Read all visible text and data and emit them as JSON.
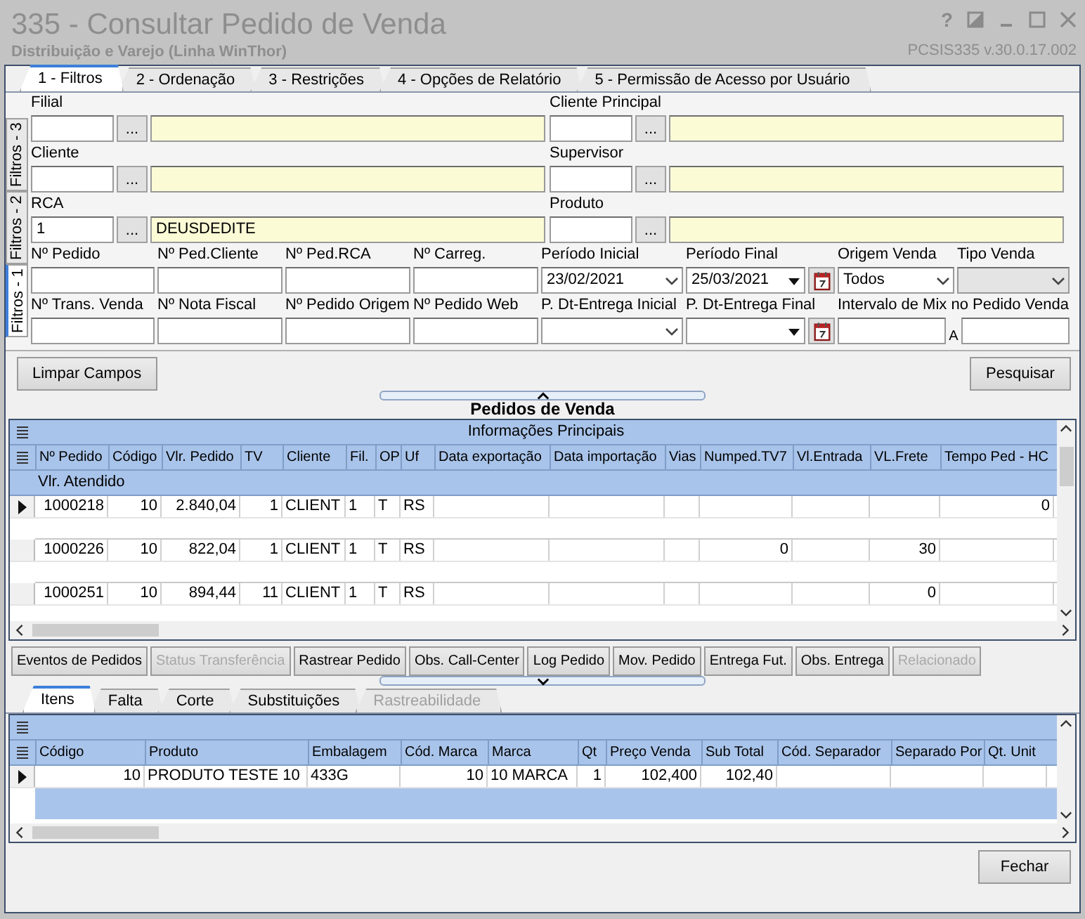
{
  "window": {
    "title": "335 - Consultar Pedido de Venda",
    "subtitle": "Distribuição e Varejo (Linha WinThor)",
    "version": "PCSIS335  v.30.0.17.002",
    "help": "?"
  },
  "tabs": [
    {
      "label": "1 - Filtros",
      "selected": true
    },
    {
      "label": "2 - Ordenação",
      "selected": false
    },
    {
      "label": "3 - Restrições",
      "selected": false
    },
    {
      "label": "4 - Opções de Relatório",
      "selected": false
    },
    {
      "label": "5 - Permissão de Acesso por Usuário",
      "selected": false
    }
  ],
  "side_tabs": [
    {
      "label": "Filtros - 3",
      "selected": false
    },
    {
      "label": "Filtros - 2",
      "selected": false
    },
    {
      "label": "Filtros - 1",
      "selected": true
    }
  ],
  "lookups": [
    {
      "label": "Filial"
    },
    {
      "label": "Cliente Principal"
    },
    {
      "label": "Cliente"
    },
    {
      "label": "Supervisor"
    },
    {
      "label": "RCA",
      "code": "1",
      "name": "DEUSDEDITE"
    },
    {
      "label": "Produto"
    }
  ],
  "lookup_button": "...",
  "filter_fields": [
    {
      "label": "Nº Pedido",
      "kind": "text"
    },
    {
      "label": "Nº Ped.Cliente",
      "kind": "text"
    },
    {
      "label": "Nº Ped.RCA",
      "kind": "text"
    },
    {
      "label": "Nº Carreg.",
      "kind": "text"
    },
    {
      "label": "Período Inicial",
      "kind": "combo",
      "value": "23/02/2021",
      "disabled": false
    },
    {
      "label": "Período Final",
      "kind": "date",
      "value": "25/03/2021"
    },
    {
      "label": "Origem Venda",
      "kind": "combo",
      "value": "Todos",
      "disabled": false
    },
    {
      "label": "Tipo Venda",
      "kind": "combo",
      "disabled": true
    },
    {
      "label": "Nº Trans. Venda",
      "kind": "text"
    },
    {
      "label": "Nº Nota Fiscal",
      "kind": "text"
    },
    {
      "label": "Nº Pedido Origem",
      "kind": "text"
    },
    {
      "label": "Nº Pedido Web",
      "kind": "text"
    },
    {
      "label": "P. Dt-Entrega Inicial",
      "kind": "combo",
      "disabled": false
    },
    {
      "label": "P. Dt-Entrega Final",
      "kind": "date"
    },
    {
      "label": "Intervalo de Mix no Pedido Venda",
      "kind": "range",
      "separator": "A"
    }
  ],
  "filter_buttons": [
    "Limpar Campos",
    "Pesquisar"
  ],
  "orders": {
    "title": "Pedidos de  Venda",
    "group_header": "Informações Principais",
    "second_header": "Vlr. Atendido",
    "columns": [
      {
        "label": "Nº Pedido",
        "numeric": true
      },
      {
        "label": "Código",
        "numeric": true
      },
      {
        "label": "Vlr. Pedido",
        "numeric": true
      },
      {
        "label": "TV",
        "numeric": true
      },
      {
        "label": "Cliente",
        "numeric": false
      },
      {
        "label": "Fil.",
        "numeric": false
      },
      {
        "label": "OP",
        "numeric": false
      },
      {
        "label": "Uf",
        "numeric": false
      },
      {
        "label": "Data exportação"
      },
      {
        "label": "Data importação"
      },
      {
        "label": "Vias"
      },
      {
        "label": "Numped.TV7",
        "numeric": true
      },
      {
        "label": "Vl.Entrada"
      },
      {
        "label": "VL.Frete",
        "numeric": true
      },
      {
        "label": "Tempo Ped - HC",
        "numeric": true
      }
    ],
    "rows": [
      {
        "selected": true,
        "cells": [
          "1000218",
          "10",
          "2.840,04",
          "1",
          "CLIENT",
          "1",
          "T",
          "RS",
          null,
          null,
          null,
          null,
          null,
          null,
          "0"
        ]
      },
      {
        "selected": false,
        "cells": [
          "1000226",
          "10",
          "822,04",
          "1",
          "CLIENT",
          "1",
          "T",
          "RS",
          null,
          null,
          null,
          "0",
          null,
          "30",
          null
        ]
      },
      {
        "selected": false,
        "cells": [
          "1000251",
          "10",
          "894,44",
          "11",
          "CLIENT",
          "1",
          "T",
          "RS",
          null,
          null,
          null,
          null,
          null,
          "0",
          null
        ]
      }
    ]
  },
  "actions": [
    {
      "label": "Eventos de Pedidos",
      "disabled": false
    },
    {
      "label": "Status Transferência",
      "disabled": true
    },
    {
      "label": "Rastrear Pedido",
      "disabled": false
    },
    {
      "label": "Obs. Call-Center",
      "disabled": false
    },
    {
      "label": "Log Pedido",
      "disabled": false
    },
    {
      "label": "Mov. Pedido",
      "disabled": false
    },
    {
      "label": "Entrega Fut.",
      "disabled": false
    },
    {
      "label": "Obs. Entrega",
      "disabled": false
    },
    {
      "label": "Relacionado",
      "disabled": true
    }
  ],
  "detail_tabs": [
    {
      "label": "Itens",
      "selected": true,
      "disabled": false
    },
    {
      "label": "Falta",
      "selected": false,
      "disabled": false
    },
    {
      "label": "Corte",
      "selected": false,
      "disabled": false
    },
    {
      "label": "Substituições",
      "selected": false,
      "disabled": false
    },
    {
      "label": "Rastreabilidade",
      "selected": false,
      "disabled": true
    }
  ],
  "items": {
    "columns": [
      {
        "label": "Código",
        "numeric": true
      },
      {
        "label": "Produto",
        "numeric": false
      },
      {
        "label": "Embalagem",
        "numeric": false
      },
      {
        "label": "Cód. Marca",
        "numeric": true
      },
      {
        "label": "Marca",
        "numeric": false
      },
      {
        "label": "Qt",
        "numeric": true
      },
      {
        "label": "Preço Venda",
        "numeric": true
      },
      {
        "label": "Sub Total",
        "numeric": true
      },
      {
        "label": "Cód. Separador"
      },
      {
        "label": "Separado Por"
      },
      {
        "label": "Qt. Unit"
      }
    ],
    "rows": [
      {
        "selected": true,
        "cells": [
          "10",
          "PRODUTO TESTE 10",
          "433G",
          "10",
          "10 MARCA",
          "1",
          "102,400",
          "102,40",
          null,
          null,
          null
        ]
      }
    ]
  },
  "close_button": "Fechar"
}
